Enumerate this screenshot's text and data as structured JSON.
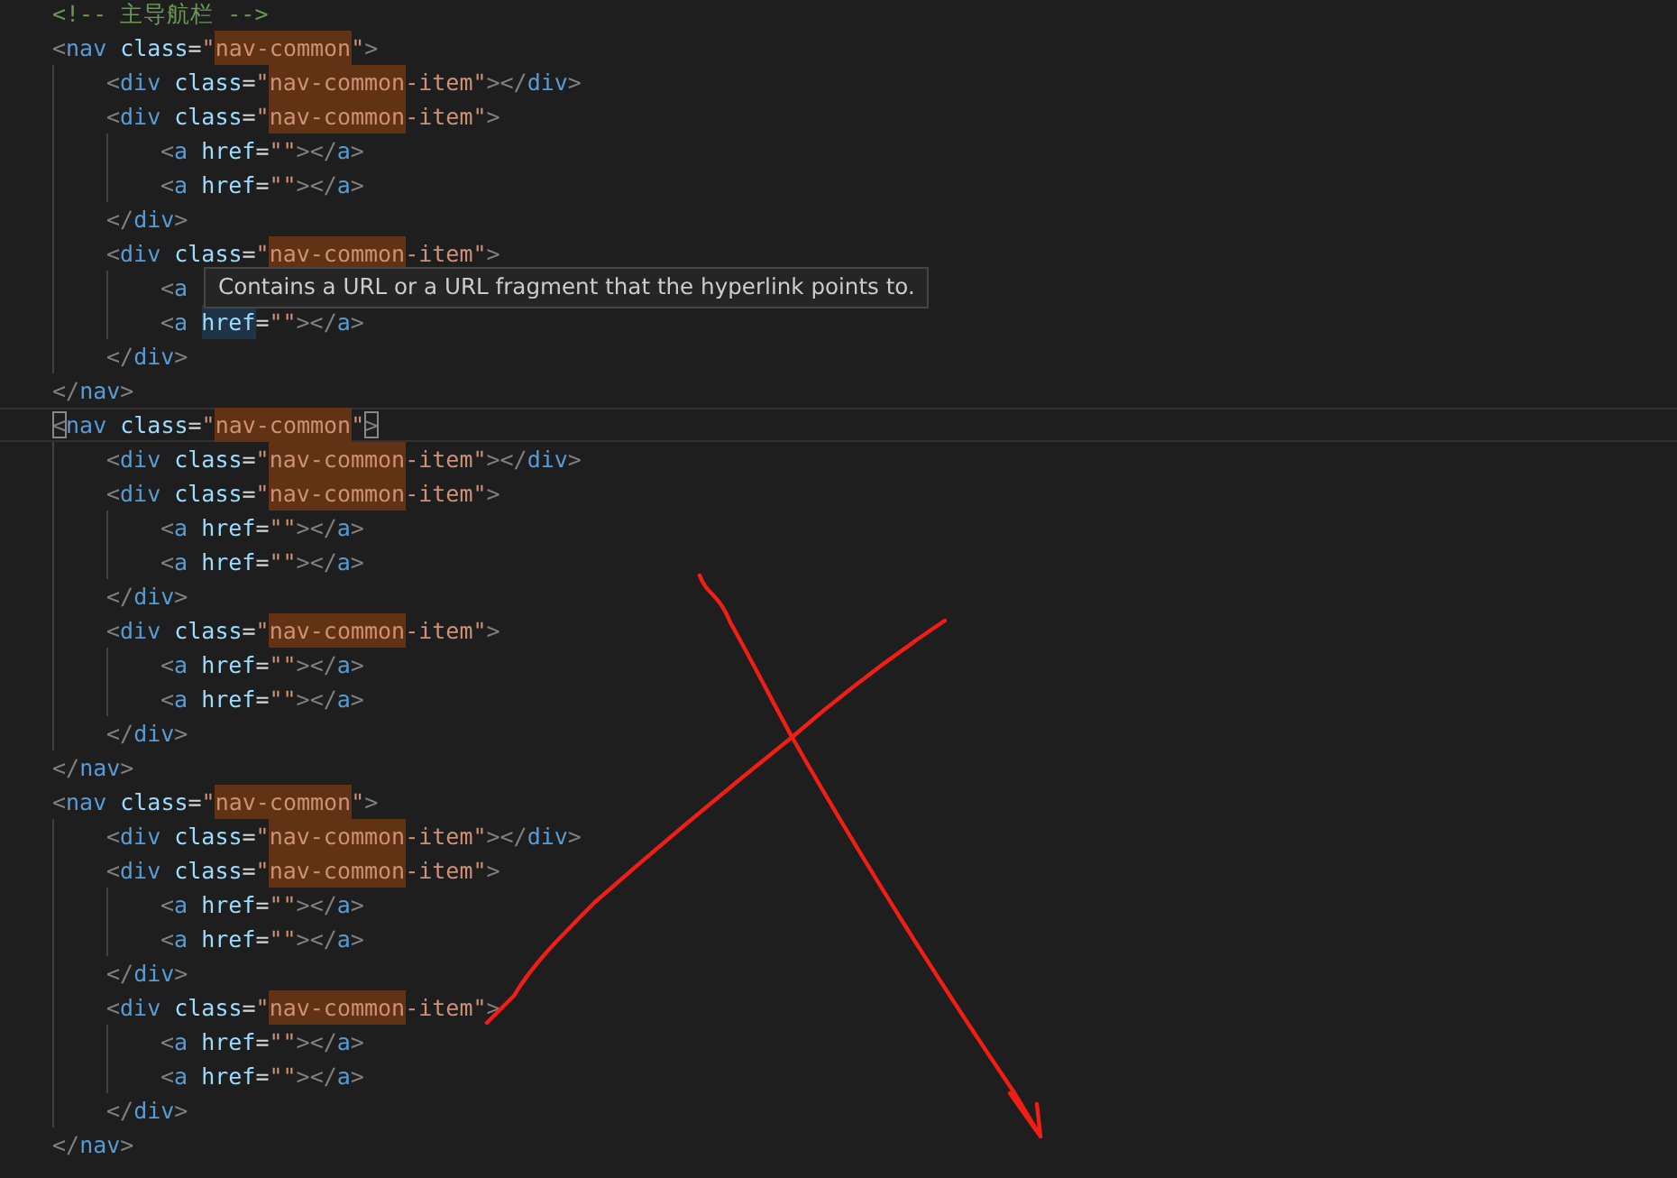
{
  "editor": {
    "lines": [
      {
        "current": false,
        "tokens": [
          {
            "t": "<!-- 主导航栏 -->",
            "kind": "comment"
          }
        ]
      },
      {
        "current": false,
        "tokens": [
          {
            "t": "<",
            "kind": "punct"
          },
          {
            "t": "nav",
            "kind": "tag"
          },
          {
            "t": " class",
            "kind": "attr"
          },
          {
            "t": "=",
            "kind": "eq"
          },
          {
            "t": "\"",
            "kind": "string"
          },
          {
            "t": "nav-common",
            "kind": "string_match"
          },
          {
            "t": "\"",
            "kind": "string"
          },
          {
            "t": ">",
            "kind": "punct"
          }
        ],
        "children": [
          {
            "current": false,
            "tokens": [
              {
                "t": "<",
                "kind": "punct"
              },
              {
                "t": "div",
                "kind": "tag"
              },
              {
                "t": " class",
                "kind": "attr"
              },
              {
                "t": "=",
                "kind": "eq"
              },
              {
                "t": "\"",
                "kind": "string"
              },
              {
                "t": "nav-common",
                "kind": "string_match"
              },
              {
                "t": "-item\"",
                "kind": "string"
              },
              {
                "t": "></",
                "kind": "punct"
              },
              {
                "t": "div",
                "kind": "tag"
              },
              {
                "t": ">",
                "kind": "punct"
              }
            ]
          },
          {
            "current": false,
            "tokens": [
              {
                "t": "<",
                "kind": "punct"
              },
              {
                "t": "div",
                "kind": "tag"
              },
              {
                "t": " class",
                "kind": "attr"
              },
              {
                "t": "=",
                "kind": "eq"
              },
              {
                "t": "\"",
                "kind": "string"
              },
              {
                "t": "nav-common",
                "kind": "string_match"
              },
              {
                "t": "-item\"",
                "kind": "string"
              },
              {
                "t": ">",
                "kind": "punct"
              }
            ],
            "children": [
              {
                "current": false,
                "tokens": [
                  {
                    "t": "<",
                    "kind": "punct"
                  },
                  {
                    "t": "a",
                    "kind": "tag"
                  },
                  {
                    "t": " href",
                    "kind": "attr"
                  },
                  {
                    "t": "=",
                    "kind": "eq"
                  },
                  {
                    "t": "\"\"",
                    "kind": "string"
                  },
                  {
                    "t": "></",
                    "kind": "punct"
                  },
                  {
                    "t": "a",
                    "kind": "tag"
                  },
                  {
                    "t": ">",
                    "kind": "punct"
                  }
                ]
              },
              {
                "current": false,
                "tokens": [
                  {
                    "t": "<",
                    "kind": "punct"
                  },
                  {
                    "t": "a",
                    "kind": "tag"
                  },
                  {
                    "t": " href",
                    "kind": "attr"
                  },
                  {
                    "t": "=",
                    "kind": "eq"
                  },
                  {
                    "t": "\"\"",
                    "kind": "string"
                  },
                  {
                    "t": "></",
                    "kind": "punct"
                  },
                  {
                    "t": "a",
                    "kind": "tag"
                  },
                  {
                    "t": ">",
                    "kind": "punct"
                  }
                ]
              }
            ]
          },
          {
            "current": false,
            "tokens": [
              {
                "t": "</",
                "kind": "punct"
              },
              {
                "t": "div",
                "kind": "tag"
              },
              {
                "t": ">",
                "kind": "punct"
              }
            ]
          },
          {
            "current": false,
            "tokens": [
              {
                "t": "<",
                "kind": "punct"
              },
              {
                "t": "div",
                "kind": "tag"
              },
              {
                "t": " class",
                "kind": "attr"
              },
              {
                "t": "=",
                "kind": "eq"
              },
              {
                "t": "\"",
                "kind": "string"
              },
              {
                "t": "nav-common",
                "kind": "string_match"
              },
              {
                "t": "-item\"",
                "kind": "string"
              },
              {
                "t": ">",
                "kind": "punct"
              }
            ],
            "children": [
              {
                "current": false,
                "tokens": [
                  {
                    "t": "<",
                    "kind": "punct"
                  },
                  {
                    "t": "a",
                    "kind": "tag"
                  }
                ]
              },
              {
                "current": false,
                "tokens": [
                  {
                    "t": "<",
                    "kind": "punct"
                  },
                  {
                    "t": "a",
                    "kind": "tag"
                  },
                  {
                    "t": "href",
                    "kind": "attr_hover"
                  },
                  {
                    "t": "=",
                    "kind": "eq"
                  },
                  {
                    "t": "\"\"",
                    "kind": "string"
                  },
                  {
                    "t": "></",
                    "kind": "punct"
                  },
                  {
                    "t": "a",
                    "kind": "tag"
                  },
                  {
                    "t": ">",
                    "kind": "punct"
                  }
                ]
              }
            ]
          },
          {
            "current": false,
            "tokens": [
              {
                "t": "</",
                "kind": "punct"
              },
              {
                "t": "div",
                "kind": "tag"
              },
              {
                "t": ">",
                "kind": "punct"
              }
            ]
          }
        ]
      },
      {
        "current": false,
        "tokens": [
          {
            "t": "</",
            "kind": "punct"
          },
          {
            "t": "nav",
            "kind": "tag"
          },
          {
            "t": ">",
            "kind": "punct"
          }
        ]
      },
      {
        "current": true,
        "tokens": [
          {
            "t": "<",
            "kind": "punct_box"
          },
          {
            "t": "nav",
            "kind": "tag"
          },
          {
            "t": " class",
            "kind": "attr"
          },
          {
            "t": "=",
            "kind": "eq"
          },
          {
            "t": "\"",
            "kind": "string"
          },
          {
            "t": "nav-common",
            "kind": "string_match"
          },
          {
            "t": "\"",
            "kind": "string"
          },
          {
            "t": ">",
            "kind": "punct_box"
          }
        ],
        "children": [
          {
            "current": false,
            "tokens": [
              {
                "t": "<",
                "kind": "punct"
              },
              {
                "t": "div",
                "kind": "tag"
              },
              {
                "t": " class",
                "kind": "attr"
              },
              {
                "t": "=",
                "kind": "eq"
              },
              {
                "t": "\"",
                "kind": "string"
              },
              {
                "t": "nav-common",
                "kind": "string_match"
              },
              {
                "t": "-item\"",
                "kind": "string"
              },
              {
                "t": "></",
                "kind": "punct"
              },
              {
                "t": "div",
                "kind": "tag"
              },
              {
                "t": ">",
                "kind": "punct"
              }
            ]
          },
          {
            "current": false,
            "tokens": [
              {
                "t": "<",
                "kind": "punct"
              },
              {
                "t": "div",
                "kind": "tag"
              },
              {
                "t": " class",
                "kind": "attr"
              },
              {
                "t": "=",
                "kind": "eq"
              },
              {
                "t": "\"",
                "kind": "string"
              },
              {
                "t": "nav-common",
                "kind": "string_match"
              },
              {
                "t": "-item\"",
                "kind": "string"
              },
              {
                "t": ">",
                "kind": "punct"
              }
            ],
            "children": [
              {
                "current": false,
                "tokens": [
                  {
                    "t": "<",
                    "kind": "punct"
                  },
                  {
                    "t": "a",
                    "kind": "tag"
                  },
                  {
                    "t": " href",
                    "kind": "attr"
                  },
                  {
                    "t": "=",
                    "kind": "eq"
                  },
                  {
                    "t": "\"\"",
                    "kind": "string"
                  },
                  {
                    "t": "></",
                    "kind": "punct"
                  },
                  {
                    "t": "a",
                    "kind": "tag"
                  },
                  {
                    "t": ">",
                    "kind": "punct"
                  }
                ]
              },
              {
                "current": false,
                "tokens": [
                  {
                    "t": "<",
                    "kind": "punct"
                  },
                  {
                    "t": "a",
                    "kind": "tag"
                  },
                  {
                    "t": " href",
                    "kind": "attr"
                  },
                  {
                    "t": "=",
                    "kind": "eq"
                  },
                  {
                    "t": "\"\"",
                    "kind": "string"
                  },
                  {
                    "t": "></",
                    "kind": "punct"
                  },
                  {
                    "t": "a",
                    "kind": "tag"
                  },
                  {
                    "t": ">",
                    "kind": "punct"
                  }
                ]
              }
            ]
          },
          {
            "current": false,
            "tokens": [
              {
                "t": "</",
                "kind": "punct"
              },
              {
                "t": "div",
                "kind": "tag"
              },
              {
                "t": ">",
                "kind": "punct"
              }
            ]
          },
          {
            "current": false,
            "tokens": [
              {
                "t": "<",
                "kind": "punct"
              },
              {
                "t": "div",
                "kind": "tag"
              },
              {
                "t": " class",
                "kind": "attr"
              },
              {
                "t": "=",
                "kind": "eq"
              },
              {
                "t": "\"",
                "kind": "string"
              },
              {
                "t": "nav-common",
                "kind": "string_match"
              },
              {
                "t": "-item\"",
                "kind": "string"
              },
              {
                "t": ">",
                "kind": "punct"
              }
            ],
            "children": [
              {
                "current": false,
                "tokens": [
                  {
                    "t": "<",
                    "kind": "punct"
                  },
                  {
                    "t": "a",
                    "kind": "tag"
                  },
                  {
                    "t": " href",
                    "kind": "attr"
                  },
                  {
                    "t": "=",
                    "kind": "eq"
                  },
                  {
                    "t": "\"\"",
                    "kind": "string"
                  },
                  {
                    "t": "></",
                    "kind": "punct"
                  },
                  {
                    "t": "a",
                    "kind": "tag"
                  },
                  {
                    "t": ">",
                    "kind": "punct"
                  }
                ]
              },
              {
                "current": false,
                "tokens": [
                  {
                    "t": "<",
                    "kind": "punct"
                  },
                  {
                    "t": "a",
                    "kind": "tag"
                  },
                  {
                    "t": " href",
                    "kind": "attr"
                  },
                  {
                    "t": "=",
                    "kind": "eq"
                  },
                  {
                    "t": "\"\"",
                    "kind": "string"
                  },
                  {
                    "t": "></",
                    "kind": "punct"
                  },
                  {
                    "t": "a",
                    "kind": "tag"
                  },
                  {
                    "t": ">",
                    "kind": "punct"
                  }
                ]
              }
            ]
          },
          {
            "current": false,
            "tokens": [
              {
                "t": "</",
                "kind": "punct"
              },
              {
                "t": "div",
                "kind": "tag"
              },
              {
                "t": ">",
                "kind": "punct"
              }
            ]
          }
        ]
      },
      {
        "current": false,
        "tokens": [
          {
            "t": "</",
            "kind": "punct"
          },
          {
            "t": "nav",
            "kind": "tag"
          },
          {
            "t": ">",
            "kind": "punct"
          }
        ]
      },
      {
        "current": false,
        "tokens": [
          {
            "t": "<",
            "kind": "punct"
          },
          {
            "t": "nav",
            "kind": "tag"
          },
          {
            "t": " class",
            "kind": "attr"
          },
          {
            "t": "=",
            "kind": "eq"
          },
          {
            "t": "\"",
            "kind": "string"
          },
          {
            "t": "nav-common",
            "kind": "string_match"
          },
          {
            "t": "\"",
            "kind": "string"
          },
          {
            "t": ">",
            "kind": "punct"
          }
        ],
        "children": [
          {
            "current": false,
            "tokens": [
              {
                "t": "<",
                "kind": "punct"
              },
              {
                "t": "div",
                "kind": "tag"
              },
              {
                "t": " class",
                "kind": "attr"
              },
              {
                "t": "=",
                "kind": "eq"
              },
              {
                "t": "\"",
                "kind": "string"
              },
              {
                "t": "nav-common",
                "kind": "string_match"
              },
              {
                "t": "-item\"",
                "kind": "string"
              },
              {
                "t": "></",
                "kind": "punct"
              },
              {
                "t": "div",
                "kind": "tag"
              },
              {
                "t": ">",
                "kind": "punct"
              }
            ]
          },
          {
            "current": false,
            "tokens": [
              {
                "t": "<",
                "kind": "punct"
              },
              {
                "t": "div",
                "kind": "tag"
              },
              {
                "t": " class",
                "kind": "attr"
              },
              {
                "t": "=",
                "kind": "eq"
              },
              {
                "t": "\"",
                "kind": "string"
              },
              {
                "t": "nav-common",
                "kind": "string_match"
              },
              {
                "t": "-item\"",
                "kind": "string"
              },
              {
                "t": ">",
                "kind": "punct"
              }
            ],
            "children": [
              {
                "current": false,
                "tokens": [
                  {
                    "t": "<",
                    "kind": "punct"
                  },
                  {
                    "t": "a",
                    "kind": "tag"
                  },
                  {
                    "t": " href",
                    "kind": "attr"
                  },
                  {
                    "t": "=",
                    "kind": "eq"
                  },
                  {
                    "t": "\"\"",
                    "kind": "string"
                  },
                  {
                    "t": "></",
                    "kind": "punct"
                  },
                  {
                    "t": "a",
                    "kind": "tag"
                  },
                  {
                    "t": ">",
                    "kind": "punct"
                  }
                ]
              },
              {
                "current": false,
                "tokens": [
                  {
                    "t": "<",
                    "kind": "punct"
                  },
                  {
                    "t": "a",
                    "kind": "tag"
                  },
                  {
                    "t": " href",
                    "kind": "attr"
                  },
                  {
                    "t": "=",
                    "kind": "eq"
                  },
                  {
                    "t": "\"\"",
                    "kind": "string"
                  },
                  {
                    "t": "></",
                    "kind": "punct"
                  },
                  {
                    "t": "a",
                    "kind": "tag"
                  },
                  {
                    "t": ">",
                    "kind": "punct"
                  }
                ]
              }
            ]
          },
          {
            "current": false,
            "tokens": [
              {
                "t": "</",
                "kind": "punct"
              },
              {
                "t": "div",
                "kind": "tag"
              },
              {
                "t": ">",
                "kind": "punct"
              }
            ]
          },
          {
            "current": false,
            "tokens": [
              {
                "t": "<",
                "kind": "punct"
              },
              {
                "t": "div",
                "kind": "tag"
              },
              {
                "t": " class",
                "kind": "attr"
              },
              {
                "t": "=",
                "kind": "eq"
              },
              {
                "t": "\"",
                "kind": "string"
              },
              {
                "t": "nav-common",
                "kind": "string_match"
              },
              {
                "t": "-item\"",
                "kind": "string"
              },
              {
                "t": ">",
                "kind": "punct"
              }
            ],
            "children": [
              {
                "current": false,
                "tokens": [
                  {
                    "t": "<",
                    "kind": "punct"
                  },
                  {
                    "t": "a",
                    "kind": "tag"
                  },
                  {
                    "t": " href",
                    "kind": "attr"
                  },
                  {
                    "t": "=",
                    "kind": "eq"
                  },
                  {
                    "t": "\"\"",
                    "kind": "string"
                  },
                  {
                    "t": "></",
                    "kind": "punct"
                  },
                  {
                    "t": "a",
                    "kind": "tag"
                  },
                  {
                    "t": ">",
                    "kind": "punct"
                  }
                ]
              },
              {
                "current": false,
                "tokens": [
                  {
                    "t": "<",
                    "kind": "punct"
                  },
                  {
                    "t": "a",
                    "kind": "tag"
                  },
                  {
                    "t": " href",
                    "kind": "attr"
                  },
                  {
                    "t": "=",
                    "kind": "eq"
                  },
                  {
                    "t": "\"\"",
                    "kind": "string"
                  },
                  {
                    "t": "></",
                    "kind": "punct"
                  },
                  {
                    "t": "a",
                    "kind": "tag"
                  },
                  {
                    "t": ">",
                    "kind": "punct"
                  }
                ]
              }
            ]
          },
          {
            "current": false,
            "tokens": [
              {
                "t": "</",
                "kind": "punct"
              },
              {
                "t": "div",
                "kind": "tag"
              },
              {
                "t": ">",
                "kind": "punct"
              }
            ]
          }
        ]
      },
      {
        "current": false,
        "tokens": [
          {
            "t": "</",
            "kind": "punct"
          },
          {
            "t": "nav",
            "kind": "tag"
          },
          {
            "t": ">",
            "kind": "punct"
          }
        ]
      }
    ]
  },
  "tooltip": {
    "text": "Contains a URL or a URL fragment that the hyperlink points to."
  }
}
